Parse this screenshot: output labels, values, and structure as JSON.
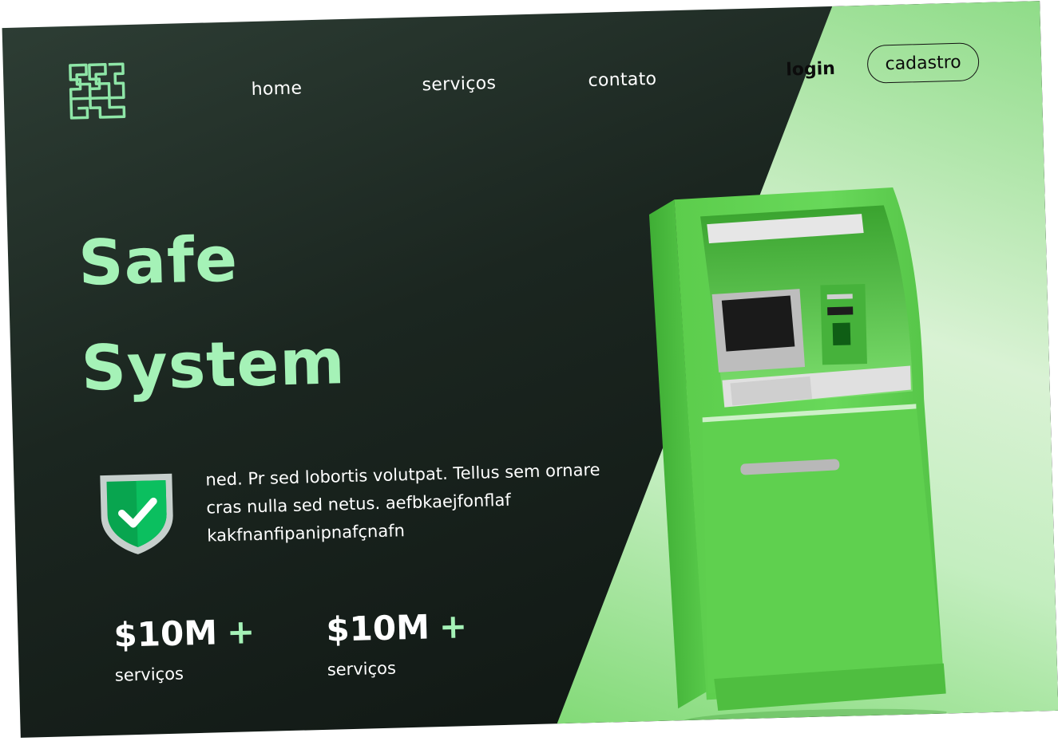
{
  "nav": {
    "home": "home",
    "servicos": "serviços",
    "contato": "contato",
    "login": "login",
    "cadastro": "cadastro"
  },
  "hero": {
    "title_line1": "Safe",
    "title_line2": "System",
    "description": "ned. Pr sed lobortis volutpat. Tellus sem ornare cras nulla sed netus. aefbkaejfonflaf kakfnanfipanipnafçnafn"
  },
  "stats": [
    {
      "value": "$10M",
      "plus": "+",
      "label": "serviços"
    },
    {
      "value": "$10M",
      "plus": "+",
      "label": "serviços"
    }
  ],
  "icons": {
    "logo": "ss-logo-icon",
    "shield": "shield-check-icon",
    "atm": "atm-machine-image"
  },
  "colors": {
    "accent": "#a5f2b7",
    "dark_bg": "#1b2620",
    "atm_green": "#5ed04e"
  }
}
